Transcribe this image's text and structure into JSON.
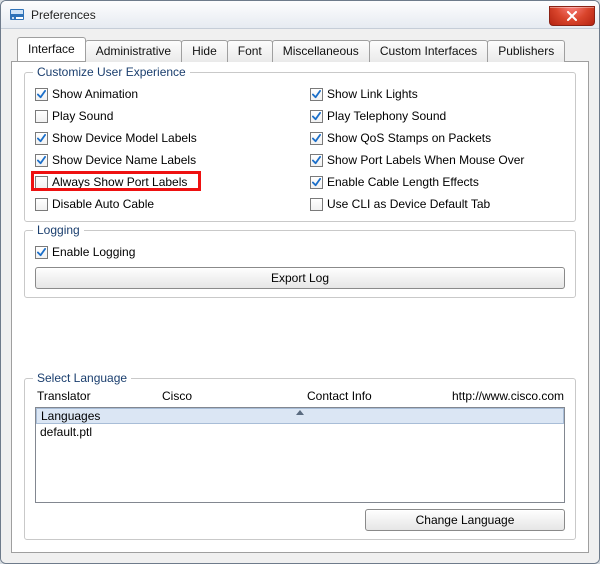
{
  "window": {
    "title": "Preferences"
  },
  "tabs": [
    {
      "label": "Interface"
    },
    {
      "label": "Administrative"
    },
    {
      "label": "Hide"
    },
    {
      "label": "Font"
    },
    {
      "label": "Miscellaneous"
    },
    {
      "label": "Custom Interfaces"
    },
    {
      "label": "Publishers"
    }
  ],
  "group_customize": {
    "legend": "Customize User Experience",
    "items": [
      {
        "label": "Show Animation",
        "checked": true
      },
      {
        "label": "Show Link Lights",
        "checked": true
      },
      {
        "label": "Play Sound",
        "checked": false
      },
      {
        "label": "Play Telephony Sound",
        "checked": true
      },
      {
        "label": "Show Device Model Labels",
        "checked": true
      },
      {
        "label": "Show QoS Stamps on Packets",
        "checked": true
      },
      {
        "label": "Show Device Name Labels",
        "checked": true
      },
      {
        "label": "Show Port Labels When Mouse Over",
        "checked": true
      },
      {
        "label": "Always Show Port Labels",
        "checked": false
      },
      {
        "label": "Enable Cable Length Effects",
        "checked": true
      },
      {
        "label": "Disable Auto Cable",
        "checked": false
      },
      {
        "label": "Use CLI as Device Default Tab",
        "checked": false
      }
    ]
  },
  "group_logging": {
    "legend": "Logging",
    "enable_label": "Enable Logging",
    "enable_checked": true,
    "export_label": "Export Log"
  },
  "group_language": {
    "legend": "Select Language",
    "headers": {
      "translator": "Translator",
      "cisco": "Cisco",
      "contact": "Contact Info",
      "url": "http://www.cisco.com"
    },
    "list_header": "Languages",
    "rows": [
      {
        "label": "default.ptl"
      }
    ],
    "change_label": "Change Language"
  }
}
